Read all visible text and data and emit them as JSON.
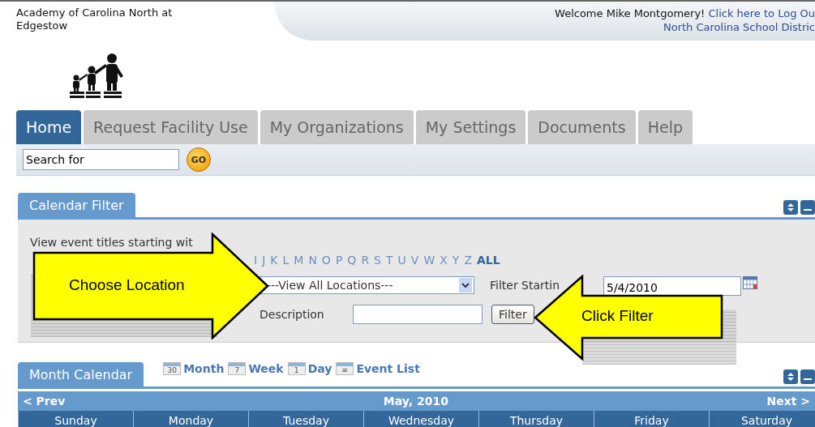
{
  "header": {
    "school_name": "Academy of Carolina North at Edgestow",
    "welcome": "Welcome Mike Montgomery!",
    "logout_link": "Click here to Log Ou",
    "district": "North Carolina School Distric"
  },
  "tabs": [
    {
      "label": "Home",
      "selected": true
    },
    {
      "label": "Request Facility Use",
      "selected": false
    },
    {
      "label": "My Organizations",
      "selected": false
    },
    {
      "label": "My Settings",
      "selected": false
    },
    {
      "label": "Documents",
      "selected": false
    },
    {
      "label": "Help",
      "selected": false
    }
  ],
  "search": {
    "value": "Search for",
    "button": "GO"
  },
  "calendar_filter": {
    "title": "Calendar Filter",
    "intro": "View event titles starting wit",
    "letters": [
      {
        "label": "I",
        "kind": "letter"
      },
      {
        "label": "J",
        "kind": "letter"
      },
      {
        "label": "K",
        "kind": "letter"
      },
      {
        "label": "L",
        "kind": "letter"
      },
      {
        "label": "M",
        "kind": "letter"
      },
      {
        "label": "N",
        "kind": "letter"
      },
      {
        "label": "O",
        "kind": "letter"
      },
      {
        "label": "P",
        "kind": "letter"
      },
      {
        "label": "Q",
        "kind": "letter"
      },
      {
        "label": "R",
        "kind": "letter"
      },
      {
        "label": "S",
        "kind": "letter"
      },
      {
        "label": "T",
        "kind": "letter"
      },
      {
        "label": "U",
        "kind": "letter"
      },
      {
        "label": "V",
        "kind": "letter"
      },
      {
        "label": "W",
        "kind": "letter"
      },
      {
        "label": "X",
        "kind": "letter"
      },
      {
        "label": "Y",
        "kind": "letter"
      },
      {
        "label": "Z",
        "kind": "letter"
      },
      {
        "label": "ALL",
        "kind": "all"
      }
    ],
    "location": "---View All Locations---",
    "filter_starting_label": "Filter Startin",
    "date": "5/4/2010",
    "description_label": "Description",
    "filter_button": "Filter"
  },
  "callouts": [
    {
      "text": "Choose Location",
      "kind": "arrow-right"
    },
    {
      "text": "Click Filter",
      "kind": "arrow-left"
    }
  ],
  "month_calendar": {
    "title": "Month Calendar",
    "views": [
      {
        "label": "Month",
        "icon_text": "30"
      },
      {
        "label": "Week",
        "icon_text": "7"
      },
      {
        "label": "Day",
        "icon_text": "1"
      },
      {
        "label": "Event List",
        "icon_text": "≡"
      }
    ],
    "prev": "< Prev",
    "month": "May, 2010",
    "next": "Next >",
    "days": [
      "Sunday",
      "Monday",
      "Tuesday",
      "Wednesday",
      "Thursday",
      "Friday",
      "Saturday"
    ]
  }
}
